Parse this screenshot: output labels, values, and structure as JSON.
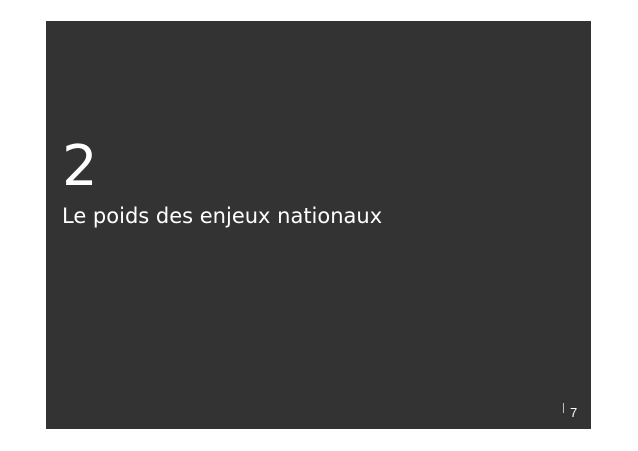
{
  "slide": {
    "background_color": "#333333",
    "text_color": "#ffffff",
    "section_number": "2",
    "section_title": "Le poids des enjeux nationaux",
    "page_number": "7"
  }
}
